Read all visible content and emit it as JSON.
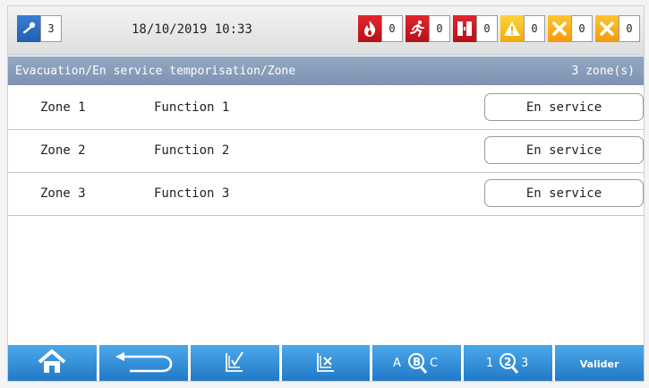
{
  "header": {
    "key_count": "3",
    "datetime": "18/10/2019 10:33",
    "indicators": [
      {
        "icon": "fire-icon",
        "count": "0",
        "color": "#d01820"
      },
      {
        "icon": "evacuation-running-man-icon",
        "count": "0",
        "color": "#d01820"
      },
      {
        "icon": "fire-door-icon",
        "count": "0",
        "color": "#d01820"
      },
      {
        "icon": "warning-triangle-icon",
        "count": "0",
        "color": "#f5b800"
      },
      {
        "icon": "fault-cross-icon",
        "count": "0",
        "color": "#f5a000"
      },
      {
        "icon": "disablement-cross-icon",
        "count": "0",
        "color": "#f5a000"
      }
    ]
  },
  "subheader": {
    "path": "Evacuation/En service temporisation/Zone",
    "zone_count": "3 zone(s)"
  },
  "zones": [
    {
      "name": "Zone 1",
      "function": "Function 1",
      "status": "En service"
    },
    {
      "name": "Zone 2",
      "function": "Function 2",
      "status": "En service"
    },
    {
      "name": "Zone 3",
      "function": "Function 3",
      "status": "En service"
    }
  ],
  "toolbar": {
    "home_icon": "home-icon",
    "back_icon": "back-arrow-icon",
    "check_icon": "select-check-icon",
    "uncheck_icon": "deselect-cross-icon",
    "abc_search_icon": "search-alphabetical-icon",
    "num_search_icon": "search-numeric-icon",
    "validate_label": "Valider",
    "abc_a": "A",
    "abc_b": "B",
    "abc_c": "C",
    "num_1": "1",
    "num_2": "2",
    "num_3": "3"
  },
  "colors": {
    "accent_blue": "#1f77c6",
    "subheader_bg": "#8499b6"
  }
}
